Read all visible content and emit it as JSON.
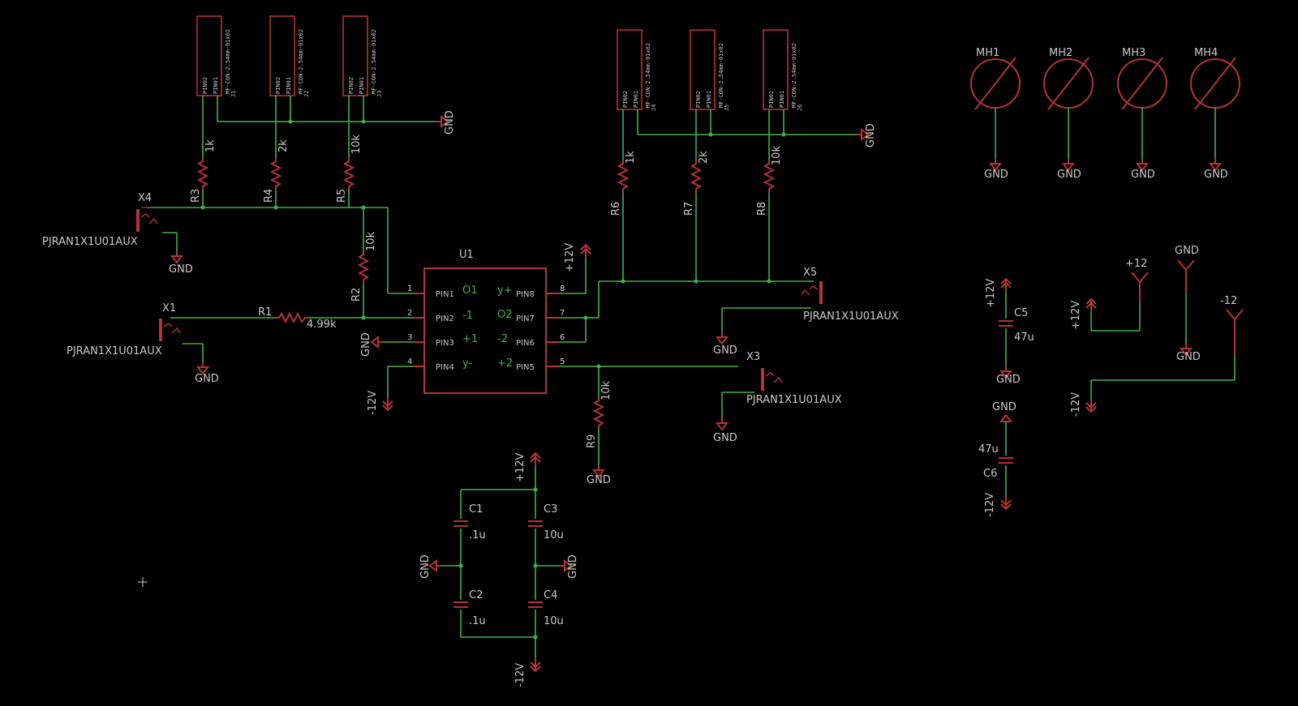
{
  "labels": {
    "X4": "X4",
    "X1": "X1",
    "X3": "X3",
    "X5": "X5",
    "jack_x4": "PJRAN1X1U01AUX",
    "jack_x1": "PJRAN1X1U01AUX",
    "jack_x3": "PJRAN1X1U01AUX",
    "jack_x5": "PJRAN1X1U01AUX",
    "U1": "U1",
    "R1": "R1",
    "R1_val": "4.99k",
    "R2": "R2",
    "R2_val": "10k",
    "R3": "R3",
    "R3_val": "1k",
    "R4": "R4",
    "R4_val": "2k",
    "R5": "R5",
    "R5_val": "10k",
    "R6": "R6",
    "R6_val": "1k",
    "R7": "R7",
    "R7_val": "2k",
    "R8": "R8",
    "R8_val": "10k",
    "R9": "R9",
    "R9_val": "10k",
    "C1": "C1",
    "C1_val": ".1u",
    "C2": "C2",
    "C2_val": ".1u",
    "C3": "C3",
    "C3_val": "10u",
    "C4": "C4",
    "C4_val": "10u",
    "C5": "C5",
    "C5_val": "47u",
    "C6": "C6",
    "C6_val": "47u",
    "MH1": "MH1",
    "MH2": "MH2",
    "MH3": "MH3",
    "MH4": "MH4",
    "gnd": "GND",
    "p12v": "+12V",
    "m12v": "-12V",
    "p12": "+12",
    "m12": "-12",
    "pin02": "PIN02",
    "pin01": "PIN01",
    "conn_val": "MF-CON-2.54mm-01x02",
    "J1": "J1",
    "J2": "J2",
    "J3": "J3",
    "J4": "J4",
    "J5": "J5",
    "J6": "J6",
    "u1_pin1": "PIN1",
    "u1_pin2": "PIN2",
    "u1_pin3": "PIN3",
    "u1_pin4": "PIN4",
    "u1_pin5": "PIN5",
    "u1_pin6": "PIN6",
    "u1_pin7": "PIN7",
    "u1_pin8": "PIN8",
    "n1": "1",
    "n2": "2",
    "n3": "3",
    "n4": "4",
    "n5": "5",
    "n6": "6",
    "n7": "7",
    "n8": "8",
    "g_o1": "O1",
    "g_m1": "-1",
    "g_p1": "+1",
    "g_ym": "y-",
    "g_yp": "y+",
    "g_o2": "O2",
    "g_m2": "-2",
    "g_p2": "+2"
  }
}
